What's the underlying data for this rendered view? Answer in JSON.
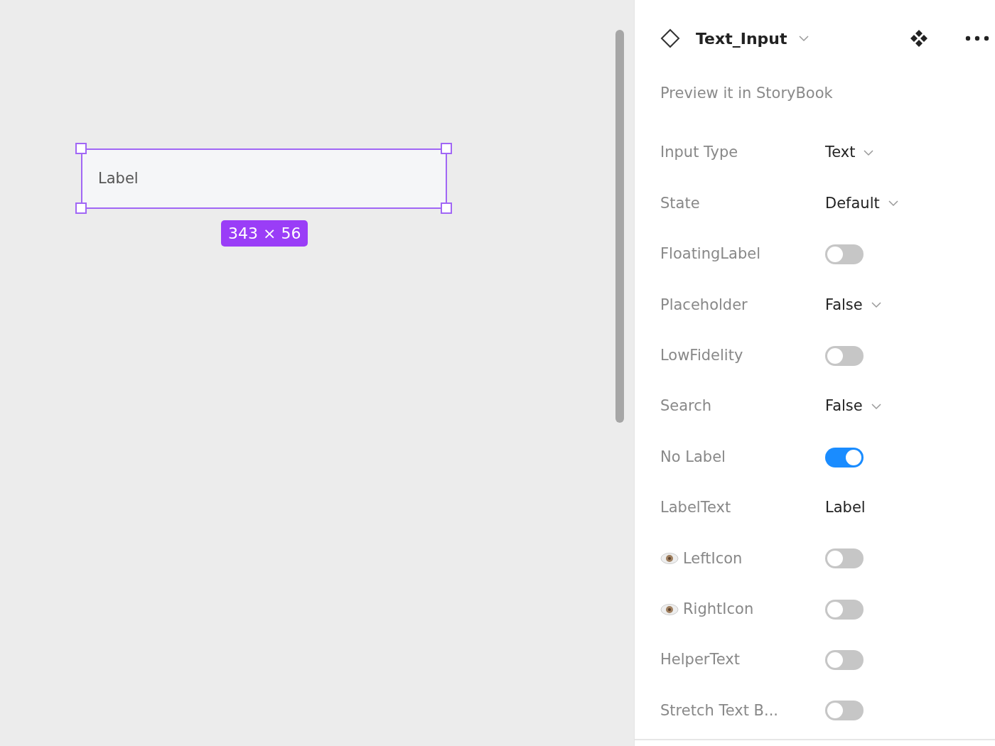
{
  "canvas": {
    "component": {
      "label": "Label",
      "selected": true
    },
    "size_badge": "343 × 56"
  },
  "panel": {
    "title": "Text_Input",
    "storybook_link": "Preview it in StoryBook",
    "properties": [
      {
        "kind": "dropdown",
        "name": "Input Type",
        "value": "Text"
      },
      {
        "kind": "dropdown",
        "name": "State",
        "value": "Default"
      },
      {
        "kind": "toggle",
        "name": "FloatingLabel",
        "on": false
      },
      {
        "kind": "dropdown",
        "name": "Placeholder",
        "value": "False"
      },
      {
        "kind": "toggle",
        "name": "LowFidelity",
        "on": false
      },
      {
        "kind": "dropdown",
        "name": "Search",
        "value": "False"
      },
      {
        "kind": "toggle",
        "name": "No Label",
        "on": true
      },
      {
        "kind": "text",
        "name": "LabelText",
        "value": "Label"
      },
      {
        "kind": "toggle",
        "name": "LeftIcon",
        "on": false,
        "eye_icon": true
      },
      {
        "kind": "toggle",
        "name": "RightIcon",
        "on": false,
        "eye_icon": true
      },
      {
        "kind": "toggle",
        "name": "HelperText",
        "on": false
      },
      {
        "kind": "toggle",
        "name": "Stretch Text B...",
        "on": false
      }
    ]
  }
}
